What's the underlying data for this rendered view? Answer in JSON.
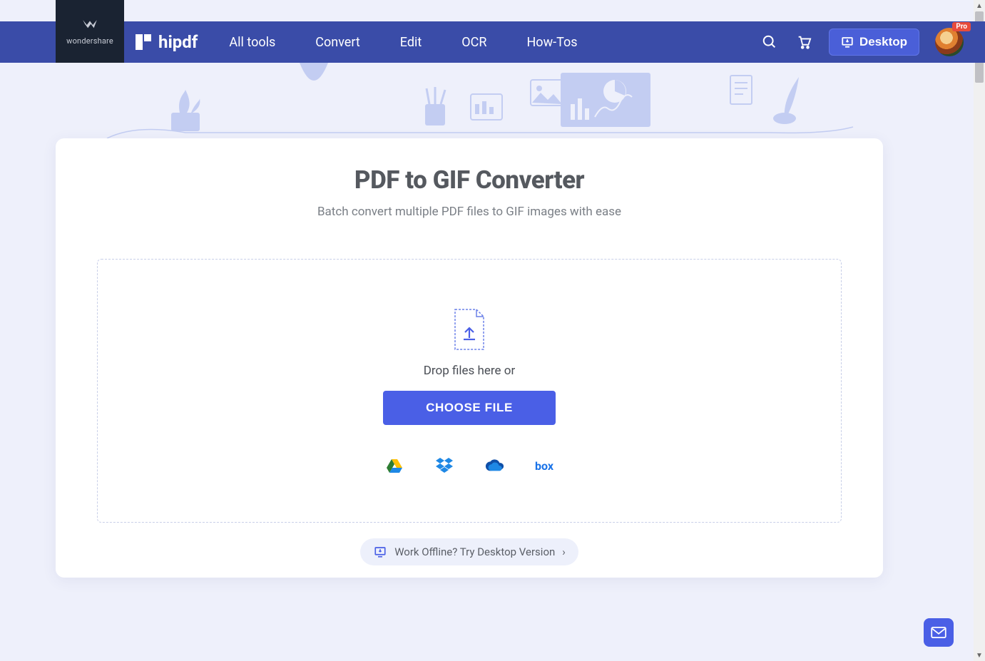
{
  "brand": {
    "name": "wondershare"
  },
  "product": {
    "name": "hipdf"
  },
  "nav": {
    "items": [
      "All tools",
      "Convert",
      "Edit",
      "OCR",
      "How-Tos"
    ],
    "desktop_label": "Desktop",
    "pro_badge": "Pro"
  },
  "page": {
    "title": "PDF to GIF Converter",
    "subtitle": "Batch convert multiple PDF files to GIF images with ease"
  },
  "dropzone": {
    "drop_text": "Drop files here or",
    "choose_label": "CHOOSE FILE",
    "cloud_sources": {
      "box_label": "box"
    }
  },
  "offline": {
    "text": "Work Offline? Try Desktop Version",
    "chevron": "›"
  },
  "colors": {
    "navbar": "#3a4ca8",
    "accent": "#4a5fe6",
    "bg": "#eef0fb"
  }
}
